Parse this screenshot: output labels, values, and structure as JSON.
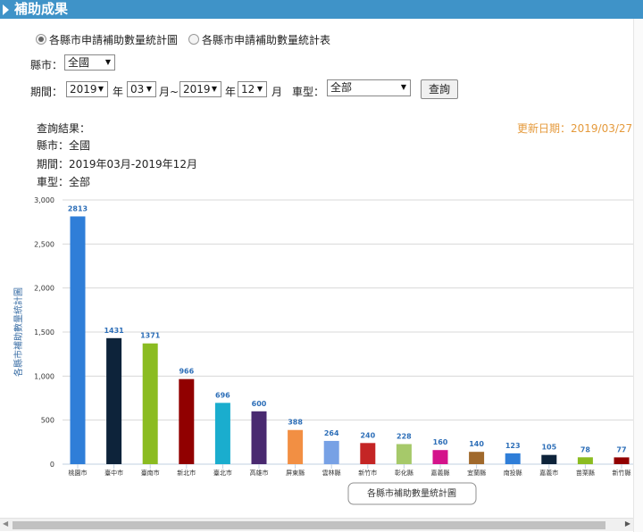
{
  "header": {
    "title": "補助成果"
  },
  "view_options": [
    {
      "label": "各縣市申請補助數量統計圖",
      "selected": true
    },
    {
      "label": "各縣市申請補助數量統計表",
      "selected": false
    }
  ],
  "filters": {
    "city_label": "縣市：",
    "city_value": "全國",
    "period_label": "期間：",
    "start_year": "2019",
    "year_unit_1": "年",
    "start_month": "03",
    "month_unit_1": "月~",
    "end_year": "2019",
    "year_unit_2": "年",
    "end_month": "12",
    "month_unit_2": "月",
    "type_label": "車型：",
    "type_value": "全部",
    "query_button": "查詢"
  },
  "results": {
    "heading": "查詢結果：",
    "city_line": "縣市：全國",
    "period_line": "期間：2019年03月-2019年12月",
    "type_line": "車型：全部",
    "updated": "更新日期：2019/03/27"
  },
  "chart_data": {
    "type": "bar",
    "ylabel": "各縣市補助數量統計圖",
    "legend": "各縣市補助數量統計圖",
    "ylim": [
      0,
      3000
    ],
    "yticks": [
      "0",
      "500",
      "1,000",
      "1,500",
      "2,000",
      "2,500",
      "3,000"
    ],
    "grid": true,
    "categories": [
      "桃園市",
      "臺中市",
      "臺南市",
      "新北市",
      "臺北市",
      "高雄市",
      "屏東縣",
      "雲林縣",
      "新竹市",
      "彰化縣",
      "嘉義縣",
      "宜蘭縣",
      "南投縣",
      "嘉義市",
      "苗栗縣",
      "新竹縣"
    ],
    "values": [
      2813,
      1431,
      1371,
      966,
      696,
      600,
      388,
      264,
      240,
      228,
      160,
      140,
      123,
      105,
      78,
      77
    ],
    "colors": [
      "#2f7ed8",
      "#0d233a",
      "#8bbc21",
      "#910000",
      "#1aadce",
      "#492970",
      "#f28f43",
      "#77a1e5",
      "#c42525",
      "#a6c96a",
      "#d4138b",
      "#a0692c",
      "#2f7ed8",
      "#0d233a",
      "#8bbc21",
      "#910000"
    ]
  }
}
